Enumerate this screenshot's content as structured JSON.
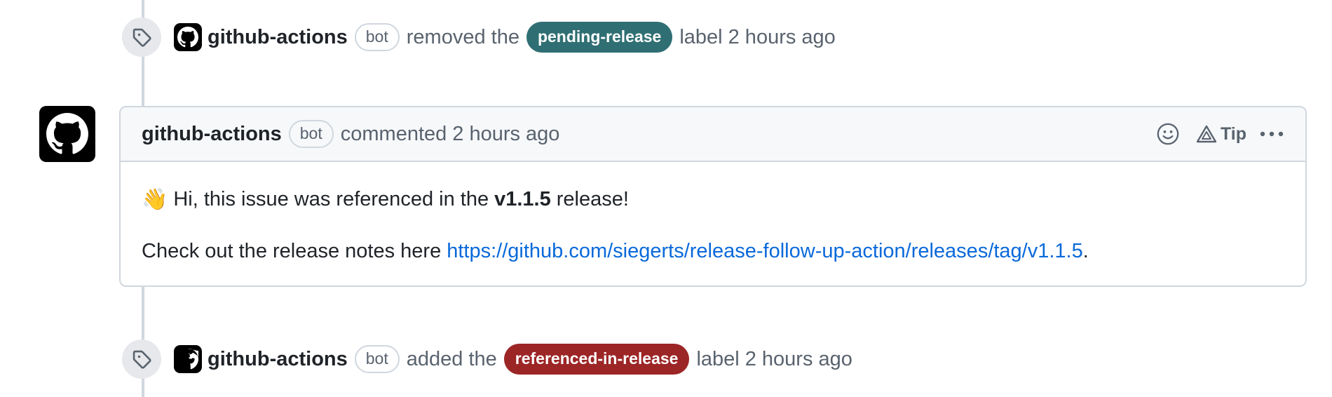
{
  "events": [
    {
      "actor": "github-actions",
      "bot_badge": "bot",
      "action": "removed the",
      "label": "pending-release",
      "label_color": "#2f6f73",
      "suffix": "label",
      "time": "2 hours ago",
      "icon": "tag-icon"
    },
    {
      "actor": "github-actions",
      "bot_badge": "bot",
      "action": "added the",
      "label": "referenced-in-release",
      "label_color": "#9c2526",
      "suffix": "label",
      "time": "2 hours ago",
      "icon": "tag-icon"
    }
  ],
  "comment": {
    "actor": "github-actions",
    "bot_badge": "bot",
    "action": "commented",
    "time": "2 hours ago",
    "tip_label": "Tip",
    "emoji": "👋",
    "line1_before": "Hi, this issue was referenced in the",
    "version": "v1.1.5",
    "line1_after": "release!",
    "line2_before": "Check out the release notes here",
    "link": "https://github.com/siegerts/release-follow-up-action/releases/tag/v1.1.5",
    "line2_after": ".",
    "icons": [
      "smiley-icon",
      "copilot-icon",
      "kebab-horizontal-icon",
      "github-mark-icon"
    ]
  },
  "colors": {
    "link": "#0969da",
    "muted": "#59636e",
    "border": "#d0d7de",
    "header_bg": "#f6f8fa"
  }
}
